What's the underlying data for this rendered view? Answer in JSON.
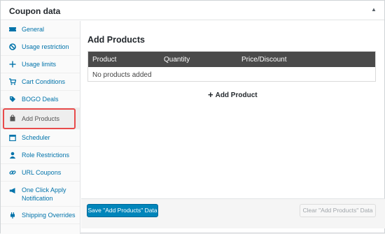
{
  "panel": {
    "title": "Coupon data",
    "toggle_glyph": "▲"
  },
  "sidebar": {
    "items": [
      {
        "label": "General",
        "icon": "ticket-icon"
      },
      {
        "label": "Usage restriction",
        "icon": "no-entry-icon"
      },
      {
        "label": "Usage limits",
        "icon": "plus-arrows-icon"
      },
      {
        "label": "Cart Conditions",
        "icon": "cart-icon"
      },
      {
        "label": "BOGO Deals",
        "icon": "tags-icon"
      },
      {
        "label": "Add Products",
        "icon": "bag-icon",
        "active": true
      },
      {
        "label": "Scheduler",
        "icon": "calendar-icon"
      },
      {
        "label": "Role Restrictions",
        "icon": "user-icon"
      },
      {
        "label": "URL Coupons",
        "icon": "link-icon"
      },
      {
        "label": "One Click Apply Notification",
        "icon": "megaphone-icon"
      },
      {
        "label": "Shipping Overrides",
        "icon": "plugin-icon"
      }
    ]
  },
  "main": {
    "title": "Add Products",
    "table": {
      "headers": [
        "Product",
        "Quantity",
        "Price/Discount"
      ],
      "empty_text": "No products added"
    },
    "add_product_label": "Add Product"
  },
  "footer": {
    "save_label": "Save \"Add Products\" Data",
    "clear_label": "Clear \"Add Products\" Data"
  },
  "colors": {
    "link": "#0073aa",
    "primary_button": "#0085ba",
    "table_header": "#4a4a4a",
    "highlight": "#e84b4b"
  }
}
